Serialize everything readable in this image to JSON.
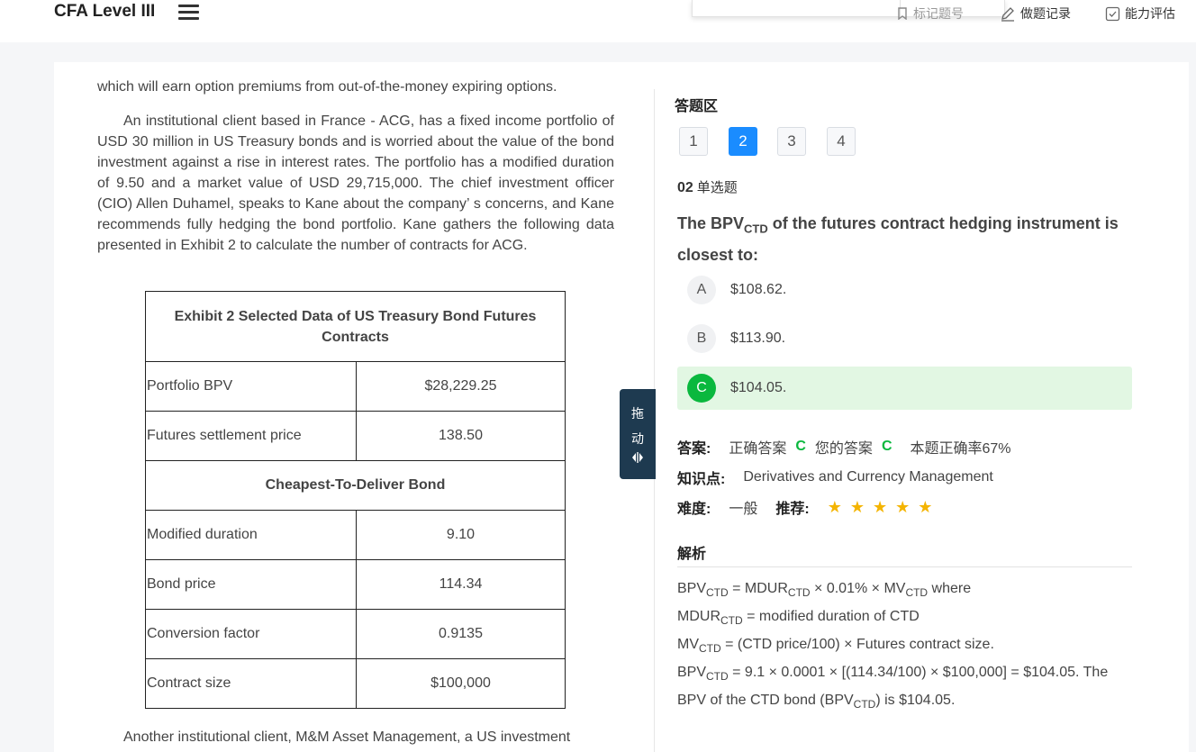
{
  "header": {
    "brand": "CFA Level III",
    "links": [
      {
        "label": "标记题号",
        "icon": "bookmark-icon"
      },
      {
        "label": "做题记录",
        "icon": "edit-icon"
      },
      {
        "label": "能力评估",
        "icon": "check-square-icon"
      }
    ]
  },
  "passage": {
    "cut_top": "which will earn option premiums from out-of-the-money expiring options.",
    "p1": "An institutional client based in France - ACG, has a fixed income portfolio of USD 30 million in US Treasury bonds and is worried about the value of the bond investment against a rise in interest rates. The portfolio has a modified duration of 9.50 and a market value of USD 29,715,000. The chief investment officer (CIO) Allen Duhamel, speaks to Kane about the company’ s concerns, and Kane recommends fully hedging the bond portfolio. Kane gathers the following data presented in Exhibit 2 to calculate the number of contracts for ACG.",
    "p2": "Another institutional client, M&M Asset Management, a US investment"
  },
  "exhibit": {
    "title": "Exhibit 2 Selected Data of US Treasury Bond Futures Contracts",
    "rows_a": [
      {
        "label": "Portfolio BPV",
        "value": "$28,229.25"
      },
      {
        "label": "Futures settlement price",
        "value": "138.50"
      }
    ],
    "subheader": "Cheapest-To-Deliver Bond",
    "rows_b": [
      {
        "label": "Modified duration",
        "value": "9.10"
      },
      {
        "label": "Bond price",
        "value": "114.34"
      },
      {
        "label": "Conversion factor",
        "value": "0.9135"
      },
      {
        "label": "Contract size",
        "value": "$100,000"
      }
    ]
  },
  "drag_handle": {
    "char1": "拖",
    "char2": "动",
    "icon": "drag-arrows-icon"
  },
  "answer_area": {
    "title": "答题区",
    "numbers": [
      "1",
      "2",
      "3",
      "4"
    ],
    "active_number": "2",
    "question_no": "02",
    "question_type": "单选题",
    "question_pre": "The BPV",
    "question_sub": "CTD",
    "question_post": " of the futures contract hedging instrument is closest to:",
    "options": [
      {
        "letter": "A",
        "text": "$108.62."
      },
      {
        "letter": "B",
        "text": "$113.90."
      },
      {
        "letter": "C",
        "text": "$104.05."
      }
    ],
    "correct_option": "C",
    "answer_label": "答案:",
    "correct_answer_label": "正确答案",
    "correct_answer": "C",
    "your_answer_label": "您的答案",
    "your_answer": "C",
    "accuracy": "本题正确率67%",
    "knowledge_label": "知识点:",
    "knowledge": "Derivatives and Currency Management",
    "difficulty_label": "难度:",
    "difficulty": "一般",
    "recommend_label": "推荐:",
    "stars": 5,
    "analysis_title": "解析",
    "analysis": {
      "bpv": "BPV",
      "ctd": "CTD",
      "mdur": "MDUR",
      "mv": "MV",
      "l1_eq": " = ",
      "l1_a": " × 0.01% × ",
      "l1_end": " where",
      "l2_rest": " = modified duration of CTD",
      "l3_rest": " = (CTD price/100) × Futures contract size.",
      "l4_rest": " = 9.1 × 0.0001 × [(114.34/100) × $100,000] = $104.05. The BPV of the CTD bond (",
      "l4_end": ") is $104.05."
    }
  },
  "colors": {
    "accent_blue": "#1a8cff",
    "correct_green": "#0ab83e",
    "correct_bg": "#e2f7e3",
    "star": "#f4b400",
    "drag_bg": "#1e3a50"
  }
}
